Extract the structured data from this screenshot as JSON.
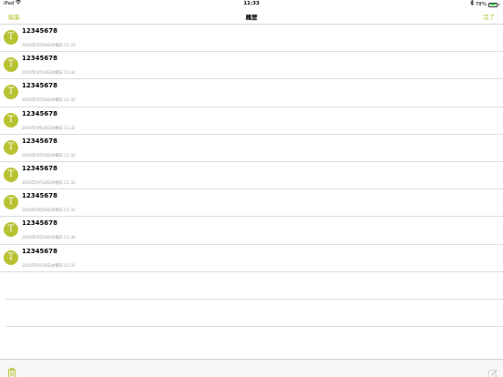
{
  "status_bar": {
    "device": "iPad",
    "time": "11:33",
    "battery": "78%",
    "battery_level": 0.78
  },
  "nav": {
    "edit_label": "編集",
    "title": "履歴",
    "done_label": "完了"
  },
  "history": [
    {
      "avatar": "T",
      "title": "12345678",
      "date": "2016年9月28日水曜日 11:33"
    },
    {
      "avatar": "T",
      "title": "12345678",
      "date": "2016年9月28日水曜日 11:32"
    },
    {
      "avatar": "T",
      "title": "12345678",
      "date": "2016年9月28日水曜日 11:32"
    },
    {
      "avatar": "T",
      "title": "12345678",
      "date": "2016年9月28日水曜日 11:32"
    },
    {
      "avatar": "T",
      "title": "12345678",
      "date": "2016年9月28日水曜日 11:32"
    },
    {
      "avatar": "T",
      "title": "12345678",
      "date": "2016年9月28日水曜日 11:32"
    },
    {
      "avatar": "T",
      "title": "12345678",
      "date": "2016年9月28日水曜日 11:32"
    },
    {
      "avatar": "T",
      "title": "12345678",
      "date": "2016年9月28日水曜日 11:30"
    },
    {
      "avatar": "T",
      "title": "12345678",
      "date": "2016年9月28日水曜日 11:31"
    }
  ],
  "icons": {
    "trash": "trash-icon",
    "compose": "compose-icon",
    "wifi": "wifi-icon",
    "bluetooth": "bluetooth-icon"
  },
  "colors": {
    "accent": "#b8c231",
    "battery": "#4cd964"
  }
}
